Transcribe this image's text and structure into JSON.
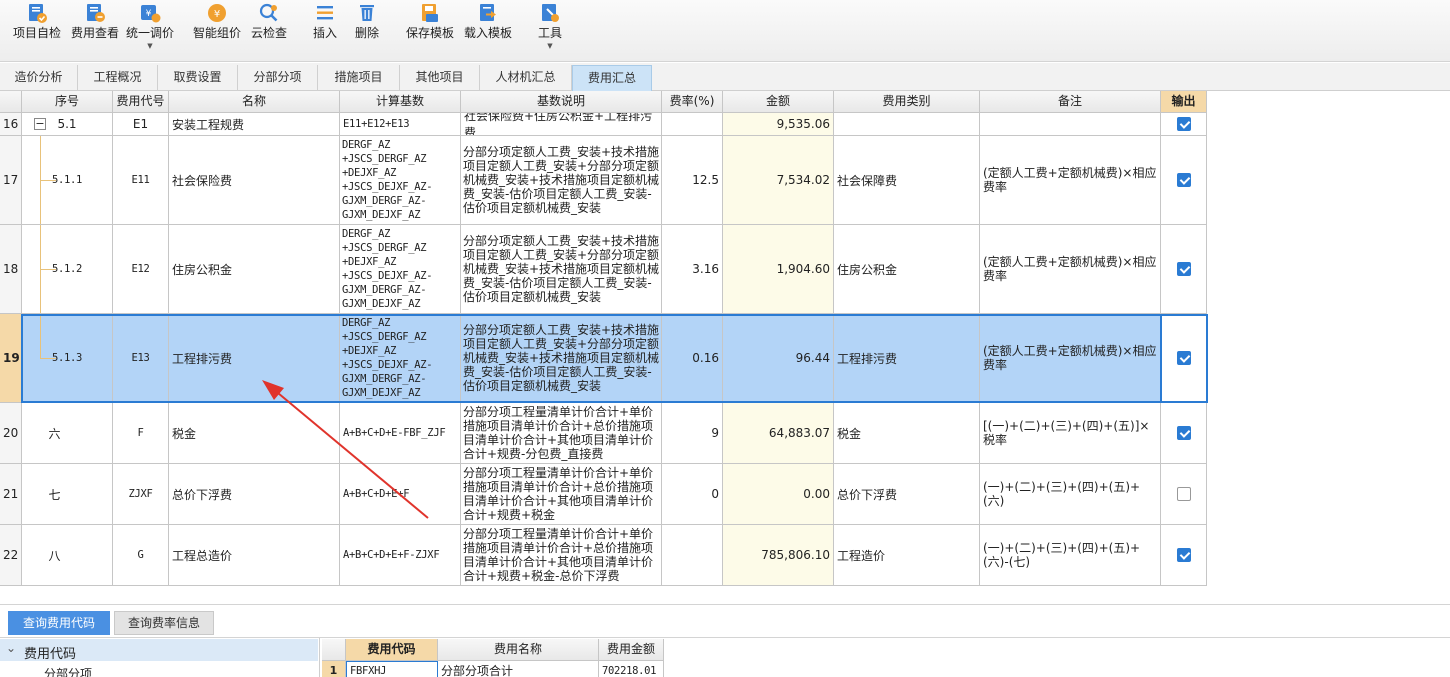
{
  "toolbar": {
    "buttons": [
      {
        "label": "项目自检",
        "icon": "check-doc-icon",
        "caret": false
      },
      {
        "label": "费用查看",
        "icon": "view-fee-icon",
        "caret": false
      },
      {
        "label": "统一调价",
        "icon": "price-adjust-icon",
        "caret": true
      },
      {
        "label": "智能组价",
        "icon": "smart-price-icon",
        "caret": false
      },
      {
        "label": "云检查",
        "icon": "cloud-check-icon",
        "caret": false
      },
      {
        "label": "插入",
        "icon": "insert-icon",
        "caret": false
      },
      {
        "label": "删除",
        "icon": "delete-icon",
        "caret": false
      },
      {
        "label": "保存模板",
        "icon": "save-template-icon",
        "caret": false
      },
      {
        "label": "载入模板",
        "icon": "load-template-icon",
        "caret": false
      },
      {
        "label": "工具",
        "icon": "tools-icon",
        "caret": true
      }
    ],
    "caret_glyph": "▼"
  },
  "tabs": [
    {
      "label": "造价分析",
      "active": false
    },
    {
      "label": "工程概况",
      "active": false
    },
    {
      "label": "取费设置",
      "active": false
    },
    {
      "label": "分部分项",
      "active": false
    },
    {
      "label": "措施项目",
      "active": false
    },
    {
      "label": "其他项目",
      "active": false
    },
    {
      "label": "人材机汇总",
      "active": false
    },
    {
      "label": "费用汇总",
      "active": true
    }
  ],
  "grid": {
    "headers": [
      "",
      "序号",
      "费用代号",
      "名称",
      "计算基数",
      "基数说明",
      "费率(%)",
      "金额",
      "费用类别",
      "备注",
      "输出"
    ],
    "rows": [
      {
        "num": "16",
        "seq": "5.1",
        "code": "E1",
        "name": "安装工程规费",
        "base": "E11+E12+E13",
        "desc": "社会保险费+住房公积金+工程排污费",
        "rate": "",
        "amount": "9,535.06",
        "category": "",
        "remark": "",
        "output": true,
        "expander": "−"
      },
      {
        "num": "17",
        "seq": "5.1.1",
        "code": "E11",
        "name": "社会保险费",
        "base": "DERGF_AZ\n+JSCS_DERGF_AZ\n+DEJXF_AZ\n+JSCS_DEJXF_AZ-\nGJXM_DERGF_AZ-\nGJXM_DEJXF_AZ",
        "desc": "分部分项定额人工费_安装+技术措施项目定额人工费_安装+分部分项定额机械费_安装+技术措施项目定额机械费_安装-估价项目定额人工费_安装-估价项目定额机械费_安装",
        "rate": "12.5",
        "amount": "7,534.02",
        "category": "社会保障费",
        "remark": "(定额人工费+定额机械费)×相应费率",
        "output": true
      },
      {
        "num": "18",
        "seq": "5.1.2",
        "code": "E12",
        "name": "住房公积金",
        "base": "DERGF_AZ\n+JSCS_DERGF_AZ\n+DEJXF_AZ\n+JSCS_DEJXF_AZ-\nGJXM_DERGF_AZ-\nGJXM_DEJXF_AZ",
        "desc": "分部分项定额人工费_安装+技术措施项目定额人工费_安装+分部分项定额机械费_安装+技术措施项目定额机械费_安装-估价项目定额人工费_安装-估价项目定额机械费_安装",
        "rate": "3.16",
        "amount": "1,904.60",
        "category": "住房公积金",
        "remark": "(定额人工费+定额机械费)×相应费率",
        "output": true
      },
      {
        "num": "19",
        "seq": "5.1.3",
        "code": "E13",
        "name": "工程排污费",
        "base": "DERGF_AZ\n+JSCS_DERGF_AZ\n+DEJXF_AZ\n+JSCS_DEJXF_AZ-\nGJXM_DERGF_AZ-\nGJXM_DEJXF_AZ",
        "desc": "分部分项定额人工费_安装+技术措施项目定额人工费_安装+分部分项定额机械费_安装+技术措施项目定额机械费_安装-估价项目定额人工费_安装-估价项目定额机械费_安装",
        "rate": "0.16",
        "amount": "96.44",
        "category": "工程排污费",
        "remark": "(定额人工费+定额机械费)×相应费率",
        "output": true,
        "selected": true
      },
      {
        "num": "20",
        "seq": "六",
        "code": "F",
        "name": "税金",
        "base": "A+B+C+D+E-FBF_ZJF",
        "desc": "分部分项工程量清单计价合计+单价措施项目清单计价合计+总价措施项目清单计价合计+其他项目清单计价合计+规费-分包费_直接费",
        "rate": "9",
        "amount": "64,883.07",
        "category": "税金",
        "remark": "[(一)+(二)+(三)+(四)+(五)]×税率",
        "output": true
      },
      {
        "num": "21",
        "seq": "七",
        "code": "ZJXF",
        "name": "总价下浮费",
        "base": "A+B+C+D+E+F",
        "desc": "分部分项工程量清单计价合计+单价措施项目清单计价合计+总价措施项目清单计价合计+其他项目清单计价合计+规费+税金",
        "rate": "0",
        "amount": "0.00",
        "category": "总价下浮费",
        "remark": "(一)+(二)+(三)+(四)+(五)+(六)",
        "output": false
      },
      {
        "num": "22",
        "seq": "八",
        "code": "G",
        "name": "工程总造价",
        "base": "A+B+C+D+E+F-ZJXF",
        "desc": "分部分项工程量清单计价合计+单价措施项目清单计价合计+总价措施项目清单计价合计+其他项目清单计价合计+规费+税金-总价下浮费",
        "rate": "",
        "amount": "785,806.10",
        "category": "工程造价",
        "remark": "(一)+(二)+(三)+(四)+(五)+(六)-(七)",
        "output": true
      }
    ]
  },
  "bottom": {
    "tabs": [
      {
        "label": "查询费用代码",
        "active": true
      },
      {
        "label": "查询费率信息",
        "active": false
      }
    ],
    "tree": {
      "root": "费用代码",
      "child": "分部分项",
      "collapse_glyph": "⌄"
    },
    "table": {
      "headers": [
        "",
        "费用代码",
        "费用名称",
        "费用金额"
      ],
      "rows": [
        {
          "num": "1",
          "code": "FBFXHJ",
          "name": "分部分项合计",
          "amount": "702218.01"
        }
      ]
    }
  },
  "colors": {
    "accent": "#2a7bd3",
    "selected_row": "#b3d4f7",
    "amount_bg": "#fdfbe8",
    "output_header": "#f5d9a8",
    "annotation_arrow": "#e0342c"
  }
}
